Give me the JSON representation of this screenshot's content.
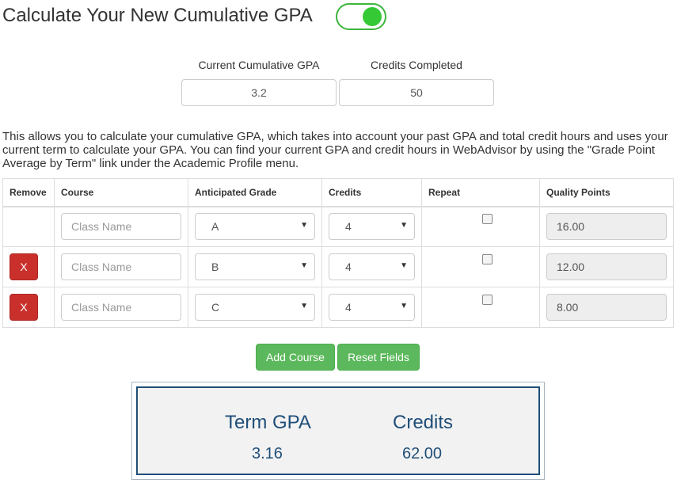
{
  "header": {
    "title": "Calculate Your New Cumulative GPA",
    "toggle_on": true
  },
  "current": {
    "gpa_label": "Current Cumulative GPA",
    "gpa_value": "3.2",
    "credits_label": "Credits Completed",
    "credits_value": "50"
  },
  "description": "This allows you to calculate your cumulative GPA, which takes into account your past GPA and total credit hours and uses your current term to calculate your GPA. You can find your current GPA and credit hours in WebAdvisor by using the \"Grade Point Average by Term\" link under the Academic Profile menu.",
  "table": {
    "headers": [
      "Remove",
      "Course",
      "Anticipated Grade",
      "Credits",
      "Repeat",
      "Quality Points"
    ],
    "rows": [
      {
        "remove_label": "",
        "course_placeholder": "Class Name",
        "grade": "A",
        "credits": "4",
        "repeat": false,
        "quality_points": "16.00"
      },
      {
        "remove_label": "X",
        "course_placeholder": "Class Name",
        "grade": "B",
        "credits": "4",
        "repeat": false,
        "quality_points": "12.00"
      },
      {
        "remove_label": "X",
        "course_placeholder": "Class Name",
        "grade": "C",
        "credits": "4",
        "repeat": false,
        "quality_points": "8.00"
      }
    ]
  },
  "buttons": {
    "add": "Add Course",
    "reset": "Reset Fields"
  },
  "results": {
    "term_gpa_label": "Term GPA",
    "term_gpa_value": "3.16",
    "credits_label": "Credits",
    "credits_value": "62.00"
  },
  "colors": {
    "accent_green": "#5cb85c",
    "danger_red": "#c9302c",
    "result_blue": "#1f4e79"
  }
}
